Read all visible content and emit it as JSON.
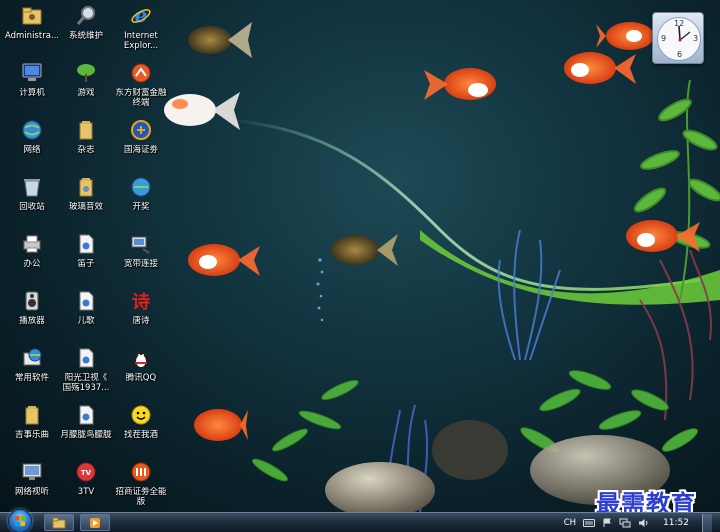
{
  "desktop": {
    "icons": [
      {
        "label": "Administra...",
        "icon": "user-folder-icon"
      },
      {
        "label": "计算机",
        "icon": "computer-icon"
      },
      {
        "label": "网络",
        "icon": "network-globe-icon"
      },
      {
        "label": "回收站",
        "icon": "recycle-bin-icon"
      },
      {
        "label": "办公",
        "icon": "office-printer-icon"
      },
      {
        "label": "播放器",
        "icon": "speaker-player-icon"
      },
      {
        "label": "常用软件",
        "icon": "software-globe-icon"
      },
      {
        "label": "吉事乐曲",
        "icon": "folder-icon"
      },
      {
        "label": "网络视听",
        "icon": "monitor-icon"
      },
      {
        "label": "系统维护",
        "icon": "magnifier-icon"
      },
      {
        "label": "游戏",
        "icon": "tree-icon"
      },
      {
        "label": "杂志",
        "icon": "folder-icon"
      },
      {
        "label": "玻璃音效",
        "icon": "folder-icon"
      },
      {
        "label": "笛子",
        "icon": "audio-file-icon"
      },
      {
        "label": "儿歌",
        "icon": "audio-file-icon"
      },
      {
        "label": "阳光卫视《\n国殇1937...",
        "icon": "video-file-icon"
      },
      {
        "label": "月朦胧鸟朦胧",
        "icon": "audio-file-icon"
      },
      {
        "label": "3TV",
        "icon": "tv-ball-icon"
      },
      {
        "label": "Internet\nExplor...",
        "icon": "internet-explorer-icon"
      },
      {
        "label": "东方财富金融\n终端",
        "icon": "finance-terminal-icon"
      },
      {
        "label": "国海证劵",
        "icon": "securities-icon"
      },
      {
        "label": "开奖",
        "icon": "lottery-globe-icon"
      },
      {
        "label": "宽带连接",
        "icon": "broadband-icon"
      },
      {
        "label": "唐诗",
        "icon": "poem-character-icon"
      },
      {
        "label": "腾讯QQ",
        "icon": "qq-penguin-icon"
      },
      {
        "label": "找茬我酒",
        "icon": "smiley-icon"
      },
      {
        "label": "招商证劵全能\n版",
        "icon": "merchants-securities-icon"
      }
    ],
    "poem_glyph": "诗",
    "clock_gadget": {
      "numbers": [
        "12",
        "3",
        "6",
        "9"
      ]
    },
    "watermark": "最需教育"
  },
  "taskbar": {
    "start_icon": "windows-logo-icon",
    "pinned": [
      {
        "name": "explorer-folder-icon"
      },
      {
        "name": "media-player-icon"
      }
    ],
    "tray": {
      "input_method": "CH",
      "icons": [
        "keyboard-icon",
        "action-flag-icon",
        "network-icon",
        "volume-icon"
      ],
      "time": "11:52"
    }
  },
  "colors": {
    "taskbar": "#1c2b3d",
    "wallpaper": "#123540",
    "watermark": "#2d3fd0"
  }
}
